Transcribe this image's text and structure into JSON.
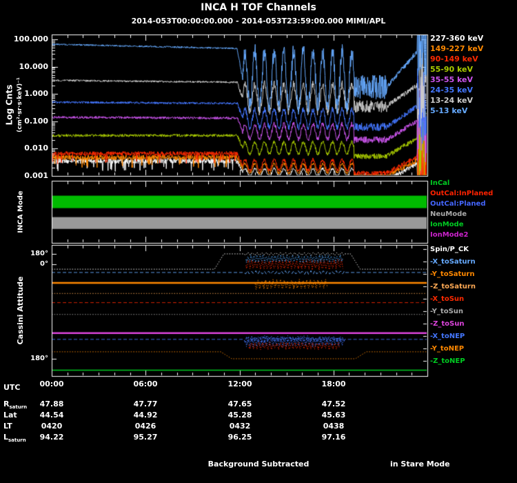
{
  "title": "INCA H TOF Channels",
  "subtitle": "2014-053T00:00:00.000 - 2014-053T23:59:00.000 MIMI/APL",
  "footer": {
    "left": "Background Subtracted",
    "right": "in Stare Mode"
  },
  "axis": {
    "utc_label": "UTC",
    "time_ticks": [
      "00:00",
      "06:00",
      "12:00",
      "18:00"
    ],
    "ylabel": "Log Cnts",
    "ylabel_units": "(cm²·sr·s·keV)⁻¹",
    "mode_panel_label": "INCA Mode",
    "attitude_panel_label": "Cassini Attitude"
  },
  "chart_data": [
    {
      "type": "line",
      "name": "h-tof-channels",
      "y_scale": "log",
      "ylim": [
        0.001,
        150
      ],
      "x_hours": [
        0,
        24
      ],
      "yticklabels": [
        "100.000",
        "10.000",
        "1.000",
        "0.100",
        "0.010",
        "0.001"
      ],
      "xticklabels": [
        "00:00",
        "06:00",
        "12:00",
        "18:00"
      ],
      "series": [
        {
          "label": "227-360 keV",
          "color": "#ffffff",
          "base_log": -2.45,
          "mid_log": -2.88,
          "osc_amp": 0.15,
          "noise": 0.1,
          "drift": 0
        },
        {
          "label": "149-227 keV",
          "color": "#ff8800",
          "base_log": -2.32,
          "mid_log": -2.72,
          "osc_amp": 0.18,
          "noise": 0.09,
          "drift": 0
        },
        {
          "label": "90-149 keV",
          "color": "#ff2a00",
          "base_log": -2.18,
          "mid_log": -2.6,
          "osc_amp": 0.2,
          "noise": 0.08,
          "drift": 0
        },
        {
          "label": "55-90 keV",
          "color": "#aacc00",
          "base_log": -1.52,
          "mid_log": -1.98,
          "osc_amp": 0.22,
          "noise": 0.05,
          "drift": 0
        },
        {
          "label": "35-55 keV",
          "color": "#cc55ee",
          "base_log": -0.85,
          "mid_log": -1.38,
          "osc_amp": 0.28,
          "noise": 0.045,
          "drift": -0.003
        },
        {
          "label": "24-35 keV",
          "color": "#4477ff",
          "base_log": -0.3,
          "mid_log": -0.9,
          "osc_amp": 0.33,
          "noise": 0.04,
          "drift": -0.004
        },
        {
          "label": "13-24 keV",
          "color": "#cccccc",
          "base_log": 0.5,
          "mid_log": -0.15,
          "osc_amp": 0.5,
          "noise": 0.035,
          "drift": -0.006
        },
        {
          "label": "5-13 keV",
          "color": "#66aaff",
          "base_log": 1.82,
          "mid_log": 0.55,
          "osc_amp": 1.0,
          "noise": 0.03,
          "drift": -0.013
        }
      ],
      "behavior": {
        "flat_until_h": 11.85,
        "oscillation_window_h": [
          12.2,
          19.3
        ],
        "oscillation_period_h": 0.62,
        "quiet_dip_h": [
          19.3,
          21.4
        ],
        "recovery_h": [
          21.4,
          23.35
        ],
        "end_spikes_from_h": 23.35
      }
    },
    {
      "type": "interval",
      "name": "inca-mode",
      "legend": [
        {
          "label": "InCal",
          "color": "#00cc22"
        },
        {
          "label": "OutCal:InPlaned",
          "color": "#ff2200"
        },
        {
          "label": "OutCal:Planed",
          "color": "#4466ff"
        },
        {
          "label": "NeuMode",
          "color": "#aaaaaa"
        },
        {
          "label": "IonMode",
          "color": "#00cc22"
        },
        {
          "label": "IonMode2",
          "color": "#cc22cc"
        }
      ],
      "bars": [
        {
          "color": "#00bb00",
          "t0_h": 0,
          "t1_h": 24,
          "center_frac": 0.34,
          "thickness_frac": 0.2
        },
        {
          "color": "#999999",
          "t0_h": 0,
          "t1_h": 24,
          "center_frac": 0.68,
          "thickness_frac": 0.19
        }
      ]
    },
    {
      "type": "line",
      "name": "cassini-attitude",
      "ytick_labels": [
        {
          "label": "180°",
          "frac": 0.068
        },
        {
          "label": "0°",
          "frac": 0.147
        },
        {
          "label": "180°",
          "frac": 0.868
        }
      ],
      "lines": [
        {
          "label": "Spin/P_CK",
          "color": "#ffffff",
          "style": "dotted",
          "width": 1,
          "points": [
            [
              0,
              0.185
            ],
            [
              10.4,
              0.185
            ],
            [
              11.0,
              0.068
            ],
            [
              19.1,
              0.068
            ],
            [
              19.7,
              0.185
            ],
            [
              24,
              0.185
            ]
          ],
          "osc": {
            "window": [
              12.3,
              18.7
            ],
            "amp": 0.008,
            "period": 0.3
          }
        },
        {
          "label": "-X_toSaturn",
          "color": "#66aaff",
          "style": "dashed",
          "width": 1,
          "points": [
            [
              0,
              0.21
            ],
            [
              24,
              0.21
            ]
          ],
          "osc": {
            "window": [
              12.3,
              18.7
            ],
            "amp": 0.01,
            "period": 0.27
          }
        },
        {
          "label": "-Y_toSaturn",
          "color": "#ff8800",
          "style": "solid",
          "width": 2.5,
          "points": [
            [
              0,
              0.29
            ],
            [
              24,
              0.29
            ]
          ]
        },
        {
          "label": "-Z_toSaturn",
          "color": "#ffaa55",
          "style": "dotted",
          "width": 1,
          "points": [
            [
              0,
              0.37
            ],
            [
              24,
              0.37
            ]
          ]
        },
        {
          "label": "-X_toSun",
          "color": "#ff2a00",
          "style": "dashed",
          "width": 1,
          "points": [
            [
              0,
              0.44
            ],
            [
              24,
              0.44
            ]
          ]
        },
        {
          "label": "-Y_toSun",
          "color": "#aaaaaa",
          "style": "dotted",
          "width": 1,
          "points": [
            [
              0,
              0.53
            ],
            [
              24,
              0.53
            ]
          ]
        },
        {
          "label": "-Z_toSun",
          "color": "#dd44dd",
          "style": "solid",
          "width": 2.5,
          "points": [
            [
              0,
              0.672
            ],
            [
              24,
              0.672
            ]
          ]
        },
        {
          "label": "-X_toNEP",
          "color": "#4477ff",
          "style": "dashed",
          "width": 1,
          "points": [
            [
              0,
              0.72
            ],
            [
              24,
              0.72
            ]
          ],
          "osc": {
            "window": [
              12.3,
              18.7
            ],
            "amp": 0.018,
            "period": 0.21
          }
        },
        {
          "label": "-Y_toNEP",
          "color": "#ff8800",
          "style": "dotted",
          "width": 1,
          "points": [
            [
              0,
              0.815
            ],
            [
              10.8,
              0.815
            ],
            [
              11.5,
              0.868
            ],
            [
              19.4,
              0.868
            ],
            [
              20.1,
              0.815
            ],
            [
              24,
              0.815
            ]
          ]
        },
        {
          "label": "-Z_toNEP",
          "color": "#00cc22",
          "style": "solid",
          "width": 1.5,
          "points": [
            [
              0,
              0.955
            ],
            [
              24,
              0.955
            ]
          ]
        }
      ],
      "overlays": [
        {
          "color": "#ff2a00",
          "center_frac": 0.15,
          "amp_frac": 0.028,
          "window_h": [
            12.4,
            18.6
          ],
          "period_h": 0.22
        },
        {
          "color": "#55aaff",
          "center_frac": 0.105,
          "amp_frac": 0.022,
          "window_h": [
            12.4,
            18.6
          ],
          "period_h": 0.19
        },
        {
          "color": "#ff8800",
          "center_frac": 0.3,
          "amp_frac": 0.026,
          "window_h": [
            13.0,
            17.6
          ],
          "period_h": 0.24
        },
        {
          "color": "#4477ff",
          "center_frac": 0.735,
          "amp_frac": 0.03,
          "window_h": [
            12.4,
            18.6
          ],
          "period_h": 0.21
        },
        {
          "color": "#ff2a00",
          "center_frac": 0.77,
          "amp_frac": 0.02,
          "window_h": [
            12.6,
            18.4
          ],
          "period_h": 0.23
        }
      ]
    }
  ],
  "ephemeris_table": {
    "rows": [
      {
        "label": "R",
        "sub": "saturn",
        "values": [
          "47.88",
          "47.77",
          "47.65",
          "47.52"
        ]
      },
      {
        "label": "Lat",
        "sub": "",
        "values": [
          "44.54",
          "44.92",
          "45.28",
          "45.63"
        ]
      },
      {
        "label": "LT",
        "sub": "",
        "values": [
          "0420",
          "0426",
          "0432",
          "0438"
        ]
      },
      {
        "label": "L",
        "sub": "saturn",
        "values": [
          "94.22",
          "95.27",
          "96.25",
          "97.16"
        ]
      }
    ]
  }
}
